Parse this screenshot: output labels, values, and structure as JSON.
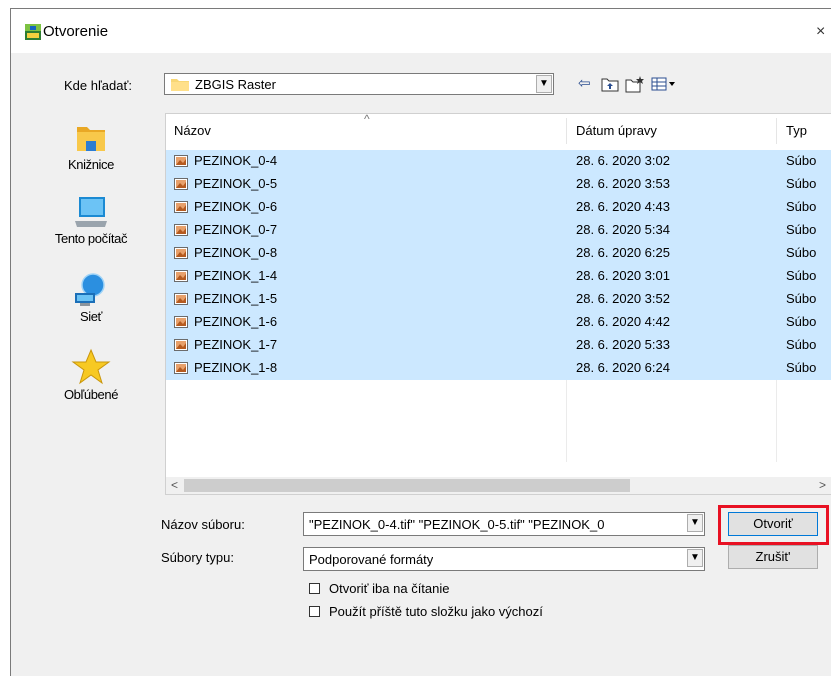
{
  "window": {
    "title": "Otvorenie",
    "close_glyph": "×",
    "icon": "raster-app-icon"
  },
  "lookin": {
    "label": "Kde hľadať:",
    "value": "ZBGIS Raster",
    "icons": [
      "back-arrow-icon",
      "up-folder-icon",
      "new-folder-icon",
      "view-menu-icon"
    ]
  },
  "places": [
    {
      "label": "Knižnice",
      "icon": "libraries-icon"
    },
    {
      "label": "Tento počítač",
      "icon": "computer-icon"
    },
    {
      "label": "Sieť",
      "icon": "network-icon"
    },
    {
      "label": "Obľúbené",
      "icon": "favorites-star-icon"
    }
  ],
  "columns": {
    "name": "Názov",
    "date": "Dátum úpravy",
    "type": "Typ"
  },
  "files": [
    {
      "name": "PEZINOK_0-4",
      "date": "28. 6. 2020 3:02",
      "type": "Súbo"
    },
    {
      "name": "PEZINOK_0-5",
      "date": "28. 6. 2020 3:53",
      "type": "Súbo"
    },
    {
      "name": "PEZINOK_0-6",
      "date": "28. 6. 2020 4:43",
      "type": "Súbo"
    },
    {
      "name": "PEZINOK_0-7",
      "date": "28. 6. 2020 5:34",
      "type": "Súbo"
    },
    {
      "name": "PEZINOK_0-8",
      "date": "28. 6. 2020 6:25",
      "type": "Súbo"
    },
    {
      "name": "PEZINOK_1-4",
      "date": "28. 6. 2020 3:01",
      "type": "Súbo"
    },
    {
      "name": "PEZINOK_1-5",
      "date": "28. 6. 2020 3:52",
      "type": "Súbo"
    },
    {
      "name": "PEZINOK_1-6",
      "date": "28. 6. 2020 4:42",
      "type": "Súbo"
    },
    {
      "name": "PEZINOK_1-7",
      "date": "28. 6. 2020 5:33",
      "type": "Súbo"
    },
    {
      "name": "PEZINOK_1-8",
      "date": "28. 6. 2020 6:24",
      "type": "Súbo"
    }
  ],
  "filename": {
    "label": "Názov súboru:",
    "value": "\"PEZINOK_0-4.tif\" \"PEZINOK_0-5.tif\" \"PEZINOK_0"
  },
  "filetype": {
    "label": "Súbory typu:",
    "value": "Podporované formáty"
  },
  "buttons": {
    "open": "Otvoriť",
    "cancel": "Zrušit'"
  },
  "options": {
    "readonly": "Otvoriť iba na čítanie",
    "default_folder": "Použít příště tuto složku jako výchozí"
  },
  "colors": {
    "selection": "#cce8ff",
    "highlight": "#e81123"
  }
}
